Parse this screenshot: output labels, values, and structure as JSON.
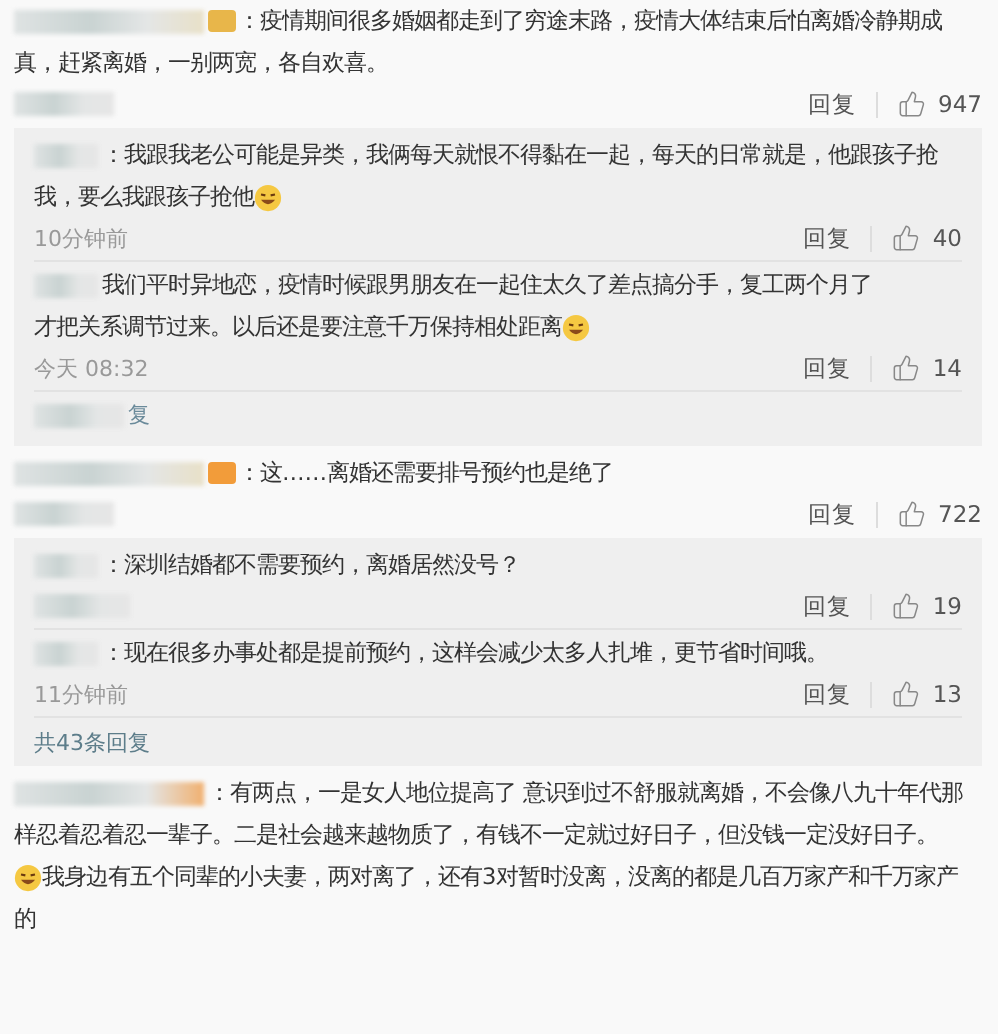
{
  "comments": [
    {
      "badge": {
        "color": "#e8b64a"
      },
      "lines": [
        [
          {
            "kind": "text",
            "text": "：疫情期间很多婚姻都走到了穷途末路，疫情大体结束后怕离婚冷静期成"
          }
        ],
        [
          {
            "kind": "text",
            "text": "真，赶紧离婚，一别两宽，各自欢喜。"
          }
        ]
      ],
      "reply": "回复",
      "likes": "947",
      "replies": [
        {
          "lines": [
            [
              {
                "kind": "text",
                "text": "：我跟我老公可能是异类，我俩每天就恨不得黏在一起，每天的日常就是，他跟孩子抢"
              }
            ],
            [
              {
                "kind": "text",
                "text": "我，要么我跟孩子抢他"
              },
              {
                "kind": "emoji"
              }
            ]
          ],
          "time": "10分钟前",
          "reply": "回复",
          "likes": "40"
        },
        {
          "lines": [
            [
              {
                "kind": "text",
                "text": "我们平时异地恋，疫情时候跟男朋友在一起住太久了差点搞分手，复工两个月了"
              }
            ],
            [
              {
                "kind": "text",
                "text": "才把关系调节过来。以后还是要注意千万保持相处距离"
              },
              {
                "kind": "emoji"
              }
            ]
          ],
          "time": "今天 08:32",
          "reply": "回复",
          "likes": "14"
        }
      ],
      "more": "复"
    },
    {
      "badge": {
        "color": "#f29c3a"
      },
      "lines": [
        [
          {
            "kind": "text",
            "text": "：这……离婚还需要排号预约也是绝了"
          }
        ]
      ],
      "reply": "回复",
      "likes": "722",
      "replies": [
        {
          "lines": [
            [
              {
                "kind": "text",
                "text": "：深圳结婚都不需要预约，离婚居然没号？"
              }
            ]
          ],
          "reply": "回复",
          "likes": "19"
        },
        {
          "lines": [
            [
              {
                "kind": "text",
                "text": "：现在很多办事处都是提前预约，这样会减少太多人扎堆，更节省时间哦。"
              }
            ]
          ],
          "time": "11分钟前",
          "reply": "回复",
          "likes": "13"
        }
      ],
      "total": "共43条回复"
    },
    {
      "lines": [
        [
          {
            "kind": "text",
            "text": "：有两点，一是女人地位提高了 意识到过不舒服就离婚，不会像八九十年代那"
          }
        ],
        [
          {
            "kind": "text",
            "text": "样忍着忍着忍一辈子。二是社会越来越物质了，有钱不一定就过好日子，但没钱一定没好日子。"
          }
        ],
        [
          {
            "kind": "emoji"
          },
          {
            "kind": "text",
            "text": "我身边有五个同辈的小夫妻，两对离了，还有3对暂时没离，没离的都是几百万家产和千万家产"
          }
        ],
        [
          {
            "kind": "text",
            "text": "的"
          }
        ]
      ]
    }
  ]
}
